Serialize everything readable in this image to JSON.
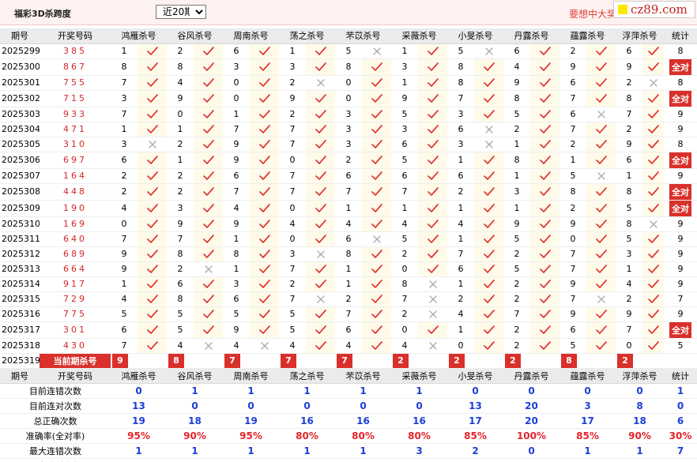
{
  "header": {
    "title": "福彩3D杀跨度",
    "period_select": "近20期",
    "slogan": "要想中大奖",
    "site": "cz89.com"
  },
  "columns": [
    "期号",
    "开奖号码",
    "鸿雁杀号",
    "谷风杀号",
    "周南杀号",
    "荡之杀号",
    "芣苡杀号",
    "采薇杀号",
    "小旻杀号",
    "丹露杀号",
    "蕴露杀号",
    "浮萍杀号",
    "统计"
  ],
  "rows": [
    {
      "period": "2025299",
      "draw": "385",
      "picks": [
        [
          "1",
          "y"
        ],
        [
          "2",
          "y"
        ],
        [
          "6",
          "y"
        ],
        [
          "1",
          "y"
        ],
        [
          "5",
          "n"
        ],
        [
          "1",
          "y"
        ],
        [
          "5",
          "n"
        ],
        [
          "6",
          "y"
        ],
        [
          "2",
          "y"
        ],
        [
          "6",
          "y"
        ]
      ],
      "stat": "8"
    },
    {
      "period": "2025300",
      "draw": "867",
      "picks": [
        [
          "8",
          "y"
        ],
        [
          "8",
          "y"
        ],
        [
          "3",
          "y"
        ],
        [
          "3",
          "y"
        ],
        [
          "8",
          "y"
        ],
        [
          "3",
          "y"
        ],
        [
          "8",
          "y"
        ],
        [
          "4",
          "y"
        ],
        [
          "9",
          "y"
        ],
        [
          "9",
          "y"
        ]
      ],
      "stat": "全对"
    },
    {
      "period": "2025301",
      "draw": "755",
      "picks": [
        [
          "7",
          "y"
        ],
        [
          "4",
          "y"
        ],
        [
          "0",
          "y"
        ],
        [
          "2",
          "n"
        ],
        [
          "0",
          "y"
        ],
        [
          "1",
          "y"
        ],
        [
          "8",
          "y"
        ],
        [
          "9",
          "y"
        ],
        [
          "6",
          "y"
        ],
        [
          "2",
          "n"
        ]
      ],
      "stat": "8"
    },
    {
      "period": "2025302",
      "draw": "715",
      "picks": [
        [
          "3",
          "y"
        ],
        [
          "9",
          "y"
        ],
        [
          "0",
          "y"
        ],
        [
          "9",
          "y"
        ],
        [
          "0",
          "y"
        ],
        [
          "9",
          "y"
        ],
        [
          "7",
          "y"
        ],
        [
          "8",
          "y"
        ],
        [
          "7",
          "y"
        ],
        [
          "8",
          "y"
        ]
      ],
      "stat": "全对"
    },
    {
      "period": "2025303",
      "draw": "933",
      "picks": [
        [
          "7",
          "y"
        ],
        [
          "0",
          "y"
        ],
        [
          "1",
          "y"
        ],
        [
          "2",
          "y"
        ],
        [
          "3",
          "y"
        ],
        [
          "5",
          "y"
        ],
        [
          "3",
          "y"
        ],
        [
          "5",
          "y"
        ],
        [
          "6",
          "n"
        ],
        [
          "7",
          "y"
        ]
      ],
      "stat": "9"
    },
    {
      "period": "2025304",
      "draw": "471",
      "picks": [
        [
          "1",
          "y"
        ],
        [
          "1",
          "y"
        ],
        [
          "7",
          "y"
        ],
        [
          "7",
          "y"
        ],
        [
          "3",
          "y"
        ],
        [
          "3",
          "y"
        ],
        [
          "6",
          "n"
        ],
        [
          "2",
          "y"
        ],
        [
          "7",
          "y"
        ],
        [
          "2",
          "y"
        ]
      ],
      "stat": "9"
    },
    {
      "period": "2025305",
      "draw": "310",
      "picks": [
        [
          "3",
          "n"
        ],
        [
          "2",
          "y"
        ],
        [
          "9",
          "y"
        ],
        [
          "7",
          "y"
        ],
        [
          "3",
          "y"
        ],
        [
          "6",
          "y"
        ],
        [
          "3",
          "n"
        ],
        [
          "1",
          "y"
        ],
        [
          "2",
          "y"
        ],
        [
          "9",
          "y"
        ]
      ],
      "stat": "8"
    },
    {
      "period": "2025306",
      "draw": "697",
      "picks": [
        [
          "6",
          "y"
        ],
        [
          "1",
          "y"
        ],
        [
          "9",
          "y"
        ],
        [
          "0",
          "y"
        ],
        [
          "2",
          "y"
        ],
        [
          "5",
          "y"
        ],
        [
          "1",
          "y"
        ],
        [
          "8",
          "y"
        ],
        [
          "1",
          "y"
        ],
        [
          "6",
          "y"
        ]
      ],
      "stat": "全对"
    },
    {
      "period": "2025307",
      "draw": "164",
      "picks": [
        [
          "2",
          "y"
        ],
        [
          "2",
          "y"
        ],
        [
          "6",
          "y"
        ],
        [
          "7",
          "y"
        ],
        [
          "6",
          "y"
        ],
        [
          "6",
          "y"
        ],
        [
          "6",
          "y"
        ],
        [
          "1",
          "y"
        ],
        [
          "5",
          "n"
        ],
        [
          "1",
          "y"
        ]
      ],
      "stat": "9"
    },
    {
      "period": "2025308",
      "draw": "448",
      "picks": [
        [
          "2",
          "y"
        ],
        [
          "2",
          "y"
        ],
        [
          "7",
          "y"
        ],
        [
          "7",
          "y"
        ],
        [
          "7",
          "y"
        ],
        [
          "7",
          "y"
        ],
        [
          "2",
          "y"
        ],
        [
          "3",
          "y"
        ],
        [
          "8",
          "y"
        ],
        [
          "8",
          "y"
        ]
      ],
      "stat": "全对"
    },
    {
      "period": "2025309",
      "draw": "190",
      "picks": [
        [
          "4",
          "y"
        ],
        [
          "3",
          "y"
        ],
        [
          "4",
          "y"
        ],
        [
          "0",
          "y"
        ],
        [
          "1",
          "y"
        ],
        [
          "1",
          "y"
        ],
        [
          "1",
          "y"
        ],
        [
          "1",
          "y"
        ],
        [
          "2",
          "y"
        ],
        [
          "5",
          "y"
        ]
      ],
      "stat": "全对"
    },
    {
      "period": "2025310",
      "draw": "169",
      "picks": [
        [
          "0",
          "y"
        ],
        [
          "9",
          "y"
        ],
        [
          "9",
          "y"
        ],
        [
          "4",
          "y"
        ],
        [
          "4",
          "y"
        ],
        [
          "4",
          "y"
        ],
        [
          "4",
          "y"
        ],
        [
          "9",
          "y"
        ],
        [
          "9",
          "y"
        ],
        [
          "8",
          "n"
        ]
      ],
      "stat": "9"
    },
    {
      "period": "2025311",
      "draw": "640",
      "picks": [
        [
          "7",
          "y"
        ],
        [
          "7",
          "y"
        ],
        [
          "1",
          "y"
        ],
        [
          "0",
          "y"
        ],
        [
          "6",
          "n"
        ],
        [
          "5",
          "y"
        ],
        [
          "1",
          "y"
        ],
        [
          "5",
          "y"
        ],
        [
          "0",
          "y"
        ],
        [
          "5",
          "y"
        ]
      ],
      "stat": "9"
    },
    {
      "period": "2025312",
      "draw": "689",
      "picks": [
        [
          "9",
          "y"
        ],
        [
          "8",
          "y"
        ],
        [
          "8",
          "y"
        ],
        [
          "3",
          "n"
        ],
        [
          "8",
          "y"
        ],
        [
          "2",
          "y"
        ],
        [
          "7",
          "y"
        ],
        [
          "2",
          "y"
        ],
        [
          "7",
          "y"
        ],
        [
          "3",
          "y"
        ]
      ],
      "stat": "9"
    },
    {
      "period": "2025313",
      "draw": "664",
      "picks": [
        [
          "9",
          "y"
        ],
        [
          "2",
          "n"
        ],
        [
          "1",
          "y"
        ],
        [
          "7",
          "y"
        ],
        [
          "1",
          "y"
        ],
        [
          "0",
          "y"
        ],
        [
          "6",
          "y"
        ],
        [
          "5",
          "y"
        ],
        [
          "7",
          "y"
        ],
        [
          "1",
          "y"
        ]
      ],
      "stat": "9"
    },
    {
      "period": "2025314",
      "draw": "917",
      "picks": [
        [
          "1",
          "y"
        ],
        [
          "6",
          "y"
        ],
        [
          "3",
          "y"
        ],
        [
          "2",
          "y"
        ],
        [
          "1",
          "y"
        ],
        [
          "8",
          "n"
        ],
        [
          "1",
          "y"
        ],
        [
          "2",
          "y"
        ],
        [
          "9",
          "y"
        ],
        [
          "4",
          "y"
        ]
      ],
      "stat": "9"
    },
    {
      "period": "2025315",
      "draw": "729",
      "picks": [
        [
          "4",
          "y"
        ],
        [
          "8",
          "y"
        ],
        [
          "6",
          "y"
        ],
        [
          "7",
          "n"
        ],
        [
          "2",
          "y"
        ],
        [
          "7",
          "n"
        ],
        [
          "2",
          "y"
        ],
        [
          "2",
          "y"
        ],
        [
          "7",
          "n"
        ],
        [
          "2",
          "y"
        ]
      ],
      "stat": "7"
    },
    {
      "period": "2025316",
      "draw": "775",
      "picks": [
        [
          "5",
          "y"
        ],
        [
          "5",
          "y"
        ],
        [
          "5",
          "y"
        ],
        [
          "5",
          "y"
        ],
        [
          "7",
          "y"
        ],
        [
          "2",
          "n"
        ],
        [
          "4",
          "y"
        ],
        [
          "7",
          "y"
        ],
        [
          "9",
          "y"
        ],
        [
          "9",
          "y"
        ]
      ],
      "stat": "9"
    },
    {
      "period": "2025317",
      "draw": "301",
      "picks": [
        [
          "6",
          "y"
        ],
        [
          "5",
          "y"
        ],
        [
          "9",
          "y"
        ],
        [
          "5",
          "y"
        ],
        [
          "6",
          "y"
        ],
        [
          "0",
          "y"
        ],
        [
          "1",
          "y"
        ],
        [
          "2",
          "y"
        ],
        [
          "6",
          "y"
        ],
        [
          "7",
          "y"
        ]
      ],
      "stat": "全对"
    },
    {
      "period": "2025318",
      "draw": "430",
      "picks": [
        [
          "7",
          "y"
        ],
        [
          "4",
          "n"
        ],
        [
          "4",
          "n"
        ],
        [
          "4",
          "y"
        ],
        [
          "4",
          "y"
        ],
        [
          "4",
          "n"
        ],
        [
          "0",
          "y"
        ],
        [
          "2",
          "y"
        ],
        [
          "5",
          "y"
        ],
        [
          "0",
          "y"
        ]
      ],
      "stat": "5"
    }
  ],
  "current": {
    "period": "2025319",
    "label": "当前期杀号",
    "picks": [
      "9",
      "8",
      "7",
      "7",
      "7",
      "2",
      "2",
      "2",
      "8",
      "2"
    ]
  },
  "summary": [
    {
      "label": "目前连错次数",
      "values": [
        "0",
        "1",
        "1",
        "1",
        "1",
        "1",
        "0",
        "0",
        "0",
        "0",
        "1"
      ],
      "red": false
    },
    {
      "label": "目前连对次数",
      "values": [
        "13",
        "0",
        "0",
        "0",
        "0",
        "0",
        "13",
        "20",
        "3",
        "8",
        "0"
      ],
      "red": false
    },
    {
      "label": "总正确次数",
      "values": [
        "19",
        "18",
        "19",
        "16",
        "16",
        "16",
        "17",
        "20",
        "17",
        "18",
        "6"
      ],
      "red": false
    },
    {
      "label": "准确率(全对率)",
      "values": [
        "95%",
        "90%",
        "95%",
        "80%",
        "80%",
        "80%",
        "85%",
        "100%",
        "85%",
        "90%",
        "30%"
      ],
      "red": true
    },
    {
      "label": "最大连错次数",
      "values": [
        "1",
        "1",
        "1",
        "1",
        "1",
        "3",
        "2",
        "0",
        "1",
        "1",
        "7"
      ],
      "red": false
    },
    {
      "label": "最大连对次数",
      "values": [
        "13",
        "14",
        "19",
        "10",
        "6",
        "15",
        "13",
        "20",
        "7",
        "8",
        "2"
      ],
      "red": false
    }
  ],
  "colors": {
    "accent_red": "#d9302b",
    "blue": "#1b3fd6",
    "check_red": "#e23434",
    "cross_gray": "#aaaaaa"
  }
}
